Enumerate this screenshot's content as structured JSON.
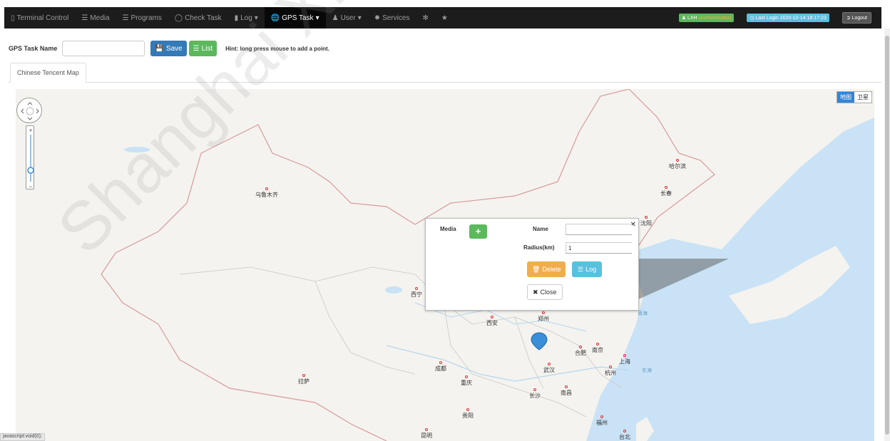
{
  "navbar": {
    "items": [
      {
        "label": "Terminal Control",
        "icon": "tablet-icon"
      },
      {
        "label": "Media",
        "icon": "list-icon"
      },
      {
        "label": "Programs",
        "icon": "list-icon"
      },
      {
        "label": "Check Task",
        "icon": "check-circle-icon"
      },
      {
        "label": "Log",
        "icon": "file-icon",
        "dropdown": true
      },
      {
        "label": "GPS Task",
        "icon": "globe-icon",
        "dropdown": true,
        "active": true
      },
      {
        "label": "User",
        "icon": "user-icon",
        "dropdown": true
      },
      {
        "label": "Services",
        "icon": "gear-icon"
      },
      {
        "label": "",
        "icon": "asterisk-icon"
      },
      {
        "label": "",
        "icon": "star-icon"
      }
    ],
    "user_label": "LXH",
    "user_status": "(Authenticator)",
    "last_login": "Last Login 2020-10-14 18:17:23",
    "logout_label": "Logout"
  },
  "task": {
    "name_label": "GPS Task Name",
    "name_value": "",
    "save_label": "Save",
    "list_label": "List",
    "hint": "Hint: long press mouse to add a point."
  },
  "tabs": {
    "map_tab": "Chinese Tencent Map"
  },
  "map": {
    "type_map": "地图",
    "type_satellite": "卫星",
    "cities": [
      {
        "name": "哈尔滨"
      },
      {
        "name": "长春"
      },
      {
        "name": "沈阳"
      },
      {
        "name": "乌鲁木齐"
      },
      {
        "name": "西宁"
      },
      {
        "name": "西安"
      },
      {
        "name": "郑州"
      },
      {
        "name": "合肥"
      },
      {
        "name": "南京"
      },
      {
        "name": "上海"
      },
      {
        "name": "杭州"
      },
      {
        "name": "武汉"
      },
      {
        "name": "成都"
      },
      {
        "name": "重庆"
      },
      {
        "name": "长沙"
      },
      {
        "name": "南昌"
      },
      {
        "name": "拉萨"
      },
      {
        "name": "贵阳"
      },
      {
        "name": "昆明"
      },
      {
        "name": "福州"
      },
      {
        "name": "台北"
      }
    ],
    "seas": [
      "黄海",
      "东海"
    ]
  },
  "popup": {
    "media_label": "Media",
    "name_label": "Name",
    "name_value": "",
    "radius_label": "Radius(km)",
    "radius_value": "1",
    "delete_label": "Delete",
    "log_label": "Log",
    "close_label": "Close"
  },
  "status_bar": "javascript:void(0);",
  "watermark": "Shanghai XiXun Elec"
}
